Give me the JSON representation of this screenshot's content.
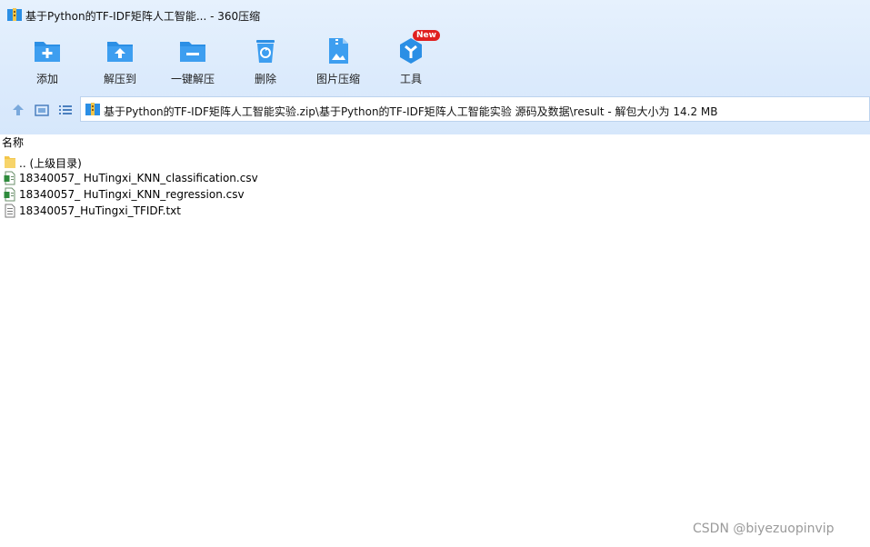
{
  "window": {
    "title": "基于Python的TF-IDF矩阵人工智能... - 360压缩"
  },
  "toolbar": {
    "items": [
      {
        "label": "添加",
        "icon": "add-folder-icon"
      },
      {
        "label": "解压到",
        "icon": "extract-to-icon"
      },
      {
        "label": "一键解压",
        "icon": "one-click-extract-icon"
      },
      {
        "label": "删除",
        "icon": "recycle-bin-icon"
      },
      {
        "label": "图片压缩",
        "icon": "image-compress-icon"
      },
      {
        "label": "工具",
        "icon": "tools-icon",
        "badge": "New"
      }
    ]
  },
  "address_bar": {
    "path": "基于Python的TF-IDF矩阵人工智能实验.zip\\基于Python的TF-IDF矩阵人工智能实验 源码及数据\\result - 解包大小为 14.2 MB"
  },
  "file_list": {
    "column_name": "名称",
    "items": [
      {
        "name": ".. (上级目录)",
        "icon": "folder-icon"
      },
      {
        "name": "18340057_ HuTingxi_KNN_classification.csv",
        "icon": "spreadsheet-file-icon"
      },
      {
        "name": "18340057_ HuTingxi_KNN_regression.csv",
        "icon": "spreadsheet-file-icon"
      },
      {
        "name": "18340057_HuTingxi_TFIDF.txt",
        "icon": "text-file-icon"
      }
    ]
  },
  "watermark": "CSDN @biyezuopinvip",
  "colors": {
    "accent_blue": "#2b8fe5",
    "badge_red": "#e02020",
    "folder_yellow": "#f3c64a"
  }
}
